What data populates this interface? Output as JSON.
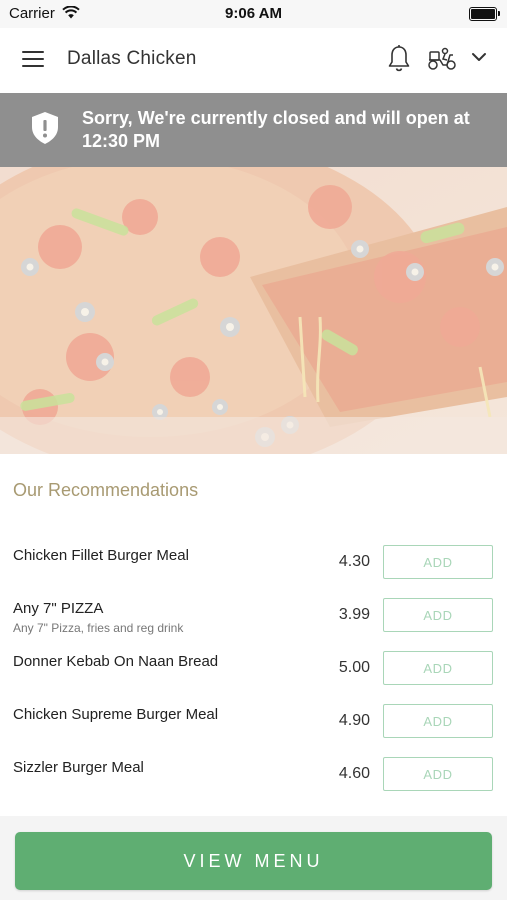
{
  "status_bar": {
    "carrier": "Carrier",
    "time": "9:06 AM"
  },
  "header": {
    "title": "Dallas Chicken",
    "icons": [
      "menu-icon",
      "bell-icon",
      "delivery-scooter-icon",
      "chevron-down-icon"
    ]
  },
  "banner": {
    "message": "Sorry, We're currently closed and will open at 12:30 PM",
    "icon": "shield-alert-icon",
    "background": "#8f8f8f"
  },
  "hero": {
    "icon": "pizza-image"
  },
  "recommendations": {
    "title": "Our Recommendations",
    "items": [
      {
        "name": "Chicken Fillet Burger Meal",
        "description": "",
        "price": "4.30",
        "button": "ADD"
      },
      {
        "name": "Any 7\" PIZZA",
        "description": "Any 7\" Pizza, fries and reg drink",
        "price": "3.99",
        "button": "ADD"
      },
      {
        "name": "Donner Kebab On Naan Bread",
        "description": "",
        "price": "5.00",
        "button": "ADD"
      },
      {
        "name": "Chicken Supreme Burger Meal",
        "description": "",
        "price": "4.90",
        "button": "ADD"
      },
      {
        "name": "Sizzler Burger Meal",
        "description": "",
        "price": "4.60",
        "button": "ADD"
      }
    ]
  },
  "footer": {
    "view_menu_label": "VIEW MENU"
  },
  "colors": {
    "accent_green": "#5fae72",
    "add_button_border": "#a9d6b8",
    "section_title": "#a89a72",
    "banner_gray": "#8f8f8f"
  }
}
